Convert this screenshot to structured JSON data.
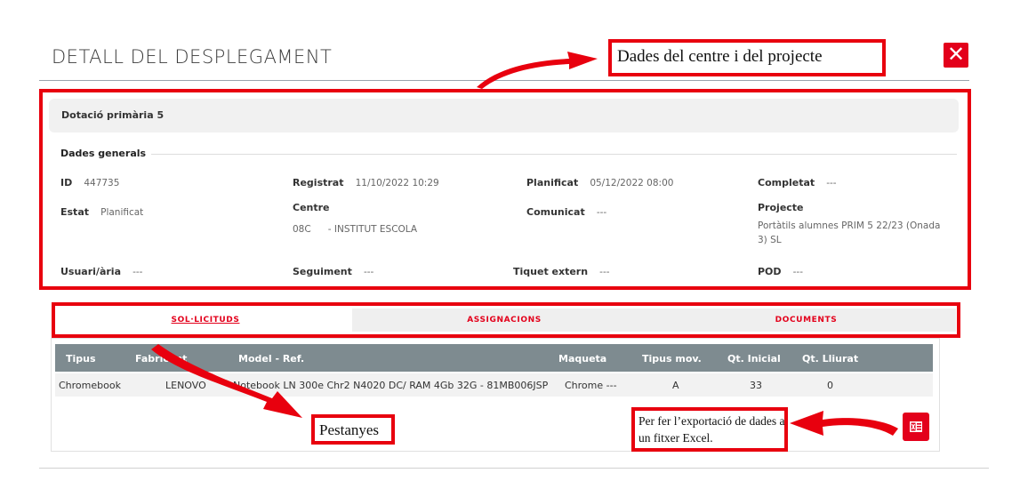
{
  "page": {
    "title": "DETALL DEL DESPLEGAMENT",
    "close_label": "✕"
  },
  "annotations": {
    "centre_project": "Dades del centre i del projecte",
    "tabs": "Pestanyes",
    "export": "Per fer l’exportació de dades a un fitxer Excel."
  },
  "panel": {
    "header": "Dotació primària 5",
    "section": "Dades generals",
    "fields": {
      "id": {
        "label": "ID",
        "value": "447735"
      },
      "registrat": {
        "label": "Registrat",
        "value": "11/10/2022 10:29"
      },
      "planificat": {
        "label": "Planificat",
        "value": "05/12/2022 08:00"
      },
      "completat": {
        "label": "Completat",
        "value": "---"
      },
      "estat": {
        "label": "Estat",
        "value": "Planificat"
      },
      "centre": {
        "label": "Centre",
        "code": "08C",
        "value": "- INSTITUT ESCOLA"
      },
      "comunicat": {
        "label": "Comunicat",
        "value": "---"
      },
      "projecte": {
        "label": "Projecte",
        "value": "Portàtils alumnes PRIM 5 22/23 (Onada 3) SL"
      },
      "usuari": {
        "label": "Usuari/ària",
        "value": "---"
      },
      "seguiment": {
        "label": "Seguiment",
        "value": "---"
      },
      "tiquet": {
        "label": "Tiquet extern",
        "value": "---"
      },
      "pod": {
        "label": "POD",
        "value": "---"
      }
    }
  },
  "tabs": [
    {
      "label": "SOL·LICITUDS",
      "active": true
    },
    {
      "label": "ASSIGNACIONS",
      "active": false
    },
    {
      "label": "DOCUMENTS",
      "active": false
    }
  ],
  "table": {
    "columns": [
      "Tipus",
      "Fabricant",
      "Model - Ref.",
      "Maqueta",
      "Tipus mov.",
      "Qt. Inicial",
      "Qt. Lliurat"
    ],
    "rows": [
      [
        "Chromebook",
        "LENOVO",
        "Notebook LN 300e Chr2 N4020 DC/ RAM 4Gb 32G - 81MB006JSP",
        "Chrome ---",
        "A",
        "33",
        "0"
      ]
    ]
  },
  "colors": {
    "accent": "#e3001b",
    "annotation_red": "#e8000e",
    "table_header": "#7e8b90"
  },
  "icons": [
    "close-icon",
    "excel-icon"
  ]
}
